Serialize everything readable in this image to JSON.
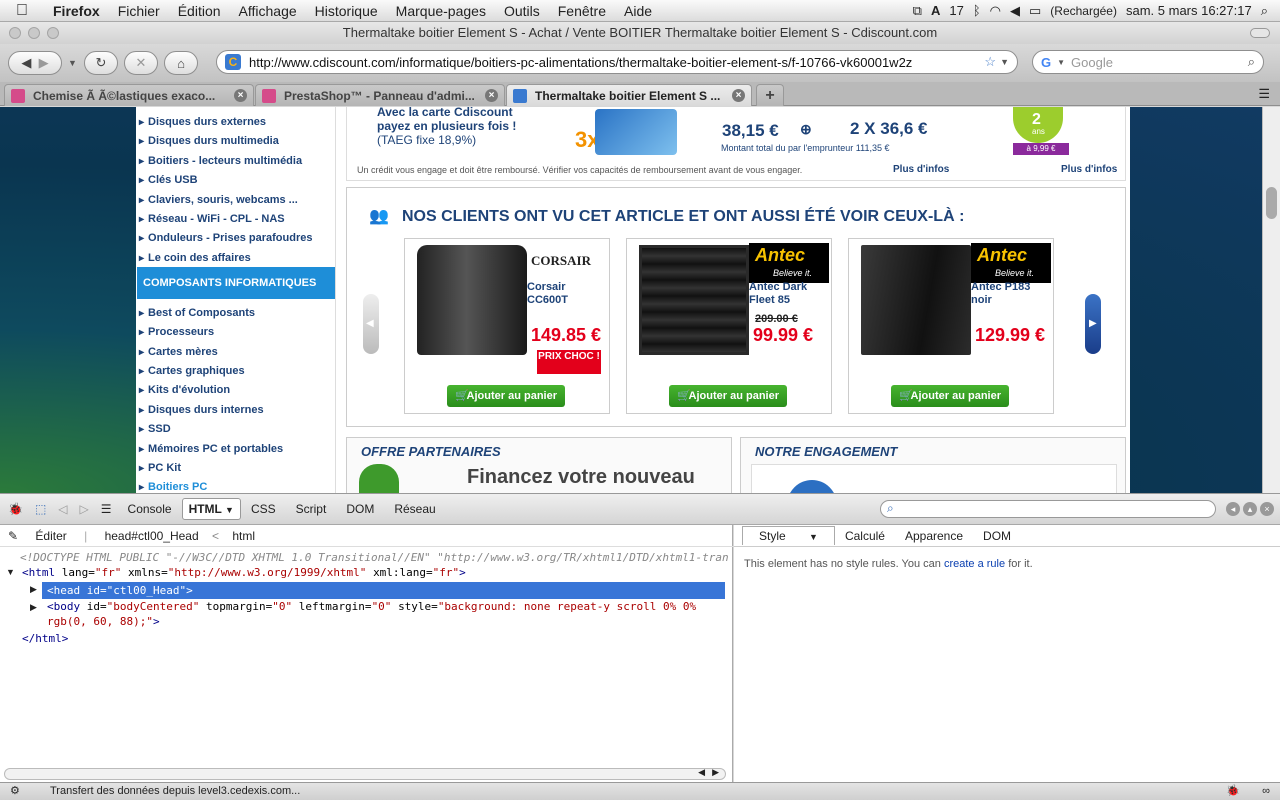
{
  "menubar": {
    "app": "Firefox",
    "items": [
      "Fichier",
      "Édition",
      "Affichage",
      "Historique",
      "Marque-pages",
      "Outils",
      "Fenêtre",
      "Aide"
    ],
    "battery_count": "17",
    "battery_label": "(Rechargée)",
    "clock": "sam. 5 mars  16:27:17"
  },
  "window": {
    "title": "Thermaltake boitier Element S - Achat / Vente BOITIER Thermaltake boitier Element S - Cdiscount.com"
  },
  "nav": {
    "url": "http://www.cdiscount.com/informatique/boitiers-pc-alimentations/thermaltake-boitier-element-s/f-10766-vk60001w2z",
    "search_placeholder": "Google"
  },
  "tabs": [
    {
      "label": "Chemise Ã  Ã©lastiques exaco...",
      "active": false
    },
    {
      "label": "PrestaShop™ - Panneau d'admi...",
      "active": false
    },
    {
      "label": "Thermaltake boitier Element S ...",
      "active": true
    }
  ],
  "page": {
    "sidebar_top": [
      "Disques durs externes",
      "Disques durs multimedia",
      "Boitiers - lecteurs multimédia",
      "Clés USB",
      "Claviers, souris, webcams ...",
      "Réseau - WiFi - CPL - NAS",
      "Onduleurs - Prises parafoudres",
      "Le coin des affaires"
    ],
    "sidebar_header": "COMPOSANTS INFORMATIQUES",
    "sidebar_bottom": [
      "Best of Composants",
      "Processeurs",
      "Cartes mères",
      "Cartes graphiques",
      "Kits d'évolution",
      "Disques durs internes",
      "SSD",
      "Mémoires PC et portables",
      "PC Kit",
      "Boitiers PC"
    ],
    "promo": {
      "line1": "Avec la carte Cdiscount",
      "line2": "payez en plusieurs fois !",
      "line3": "(TAEG fixe 18,9%)",
      "times": "3x",
      "amount1": "38,15 €",
      "amount2": "2 X 36,6 €",
      "total": "Montant total du par l'emprunteur 111,35 €",
      "disclaimer": "Un crédit vous engage et doit être remboursé. Vérifier vos capacités de remboursement avant de vous engager.",
      "more1": "Plus d'infos",
      "more2": "Plus d'infos",
      "badge_years": "2",
      "badge_unit": "ans",
      "badge_price": "à 9,99 €"
    },
    "clients_title": "NOS CLIENTS ONT VU CET ARTICLE ET ONT AUSSI ÉTÉ VOIR CEUX-LÀ :",
    "products": [
      {
        "brand": "CORSAIR",
        "name": "Corsair CC600T",
        "old_price": "",
        "price": "149.85 €",
        "badge": "PRIX CHOC !",
        "cart": "Ajouter au panier"
      },
      {
        "brand": "Antec",
        "brand_tag": "Believe it.",
        "name": "Antec Dark Fleet 85",
        "old_price": "209.00 €",
        "price": "99.99 €",
        "badge": "",
        "cart": "Ajouter au panier"
      },
      {
        "brand": "Antec",
        "brand_tag": "Believe it.",
        "name": "Antec P183 noir",
        "old_price": "",
        "price": "129.99 €",
        "badge": "",
        "cart": "Ajouter au panier"
      }
    ],
    "offre_title": "OFFRE PARTENAIRES",
    "offre_text": "Financez votre nouveau",
    "engagement_title": "NOTRE ENGAGEMENT"
  },
  "firebug": {
    "tabs": [
      "Console",
      "HTML",
      "CSS",
      "Script",
      "DOM",
      "Réseau"
    ],
    "active_tab": "HTML",
    "edit": "Éditer",
    "crumb1": "head#ctl00_Head",
    "crumb_sep": "<",
    "crumb2": "html",
    "doctype": "<!DOCTYPE HTML PUBLIC \"-//W3C//DTD XHTML 1.0 Transitional//EN\" \"http://www.w3.org/TR/xhtml1/DTD/xhtml1-tran",
    "html_open_tag": "<html",
    "html_lang_attr": "lang=",
    "html_lang_val": "\"fr\"",
    "html_xmlns_attr": "xmlns=",
    "html_xmlns_val": "\"http://www.w3.org/1999/xhtml\"",
    "html_xmllang_attr": "xml:lang=",
    "html_xmllang_val": "\"fr\"",
    "html_close_bracket": ">",
    "head_line": "<head id=\"ctl00_Head\">",
    "body_tag": "<body",
    "body_id_attr": "id=",
    "body_id_val": "\"bodyCentered\"",
    "body_top_attr": "topmargin=",
    "body_top_val": "\"0\"",
    "body_left_attr": "leftmargin=",
    "body_left_val": "\"0\"",
    "body_style_attr": "style=",
    "body_style_val": "\"background: none repeat-y scroll 0% 0%",
    "body_line2": "rgb(0, 60, 88);\"",
    "body_close_bracket": ">",
    "html_close": "</html>",
    "side_tabs": [
      "Style",
      "Calculé",
      "Apparence",
      "DOM"
    ],
    "side_msg_pre": "This element has no style rules. You can",
    "side_msg_link": "create a rule",
    "side_msg_post": "for it."
  },
  "status": "Transfert des données depuis level3.cedexis.com..."
}
